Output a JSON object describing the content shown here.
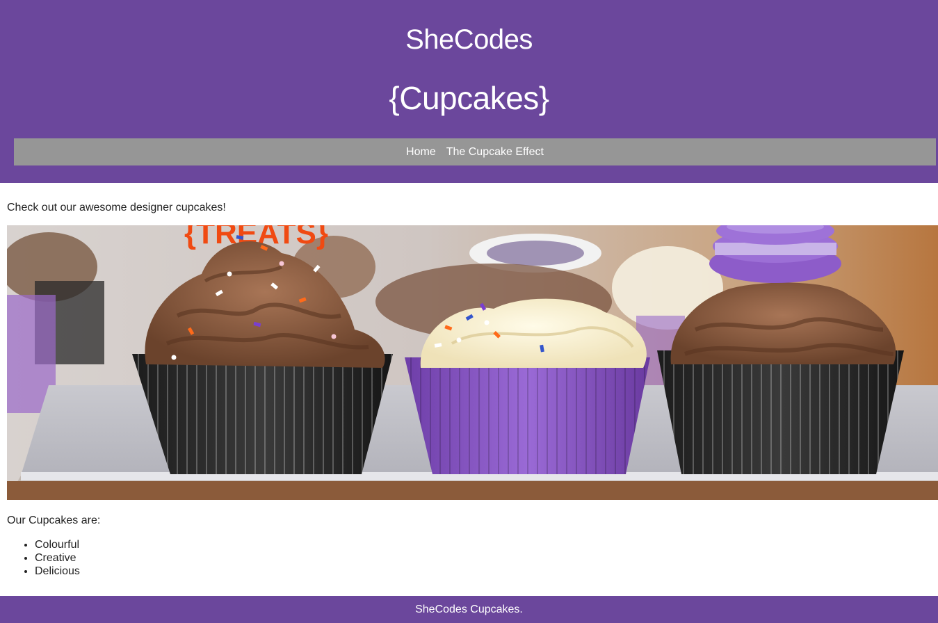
{
  "header": {
    "brand": "SheCodes",
    "title": "{Cupcakes}",
    "nav": [
      {
        "label": "Home"
      },
      {
        "label": "The Cupcake Effect"
      }
    ]
  },
  "main": {
    "intro": "Check out our awesome designer cupcakes!",
    "hero_image": "cupcakes-photo",
    "subhead": "Our Cupcakes are:",
    "features": [
      "Colourful",
      "Creative",
      "Delicious"
    ]
  },
  "footer": {
    "text": "SheCodes Cupcakes."
  },
  "colors": {
    "header_bg": "#6b479c",
    "nav_bg": "#969696",
    "footer_bg": "#6b479c"
  }
}
